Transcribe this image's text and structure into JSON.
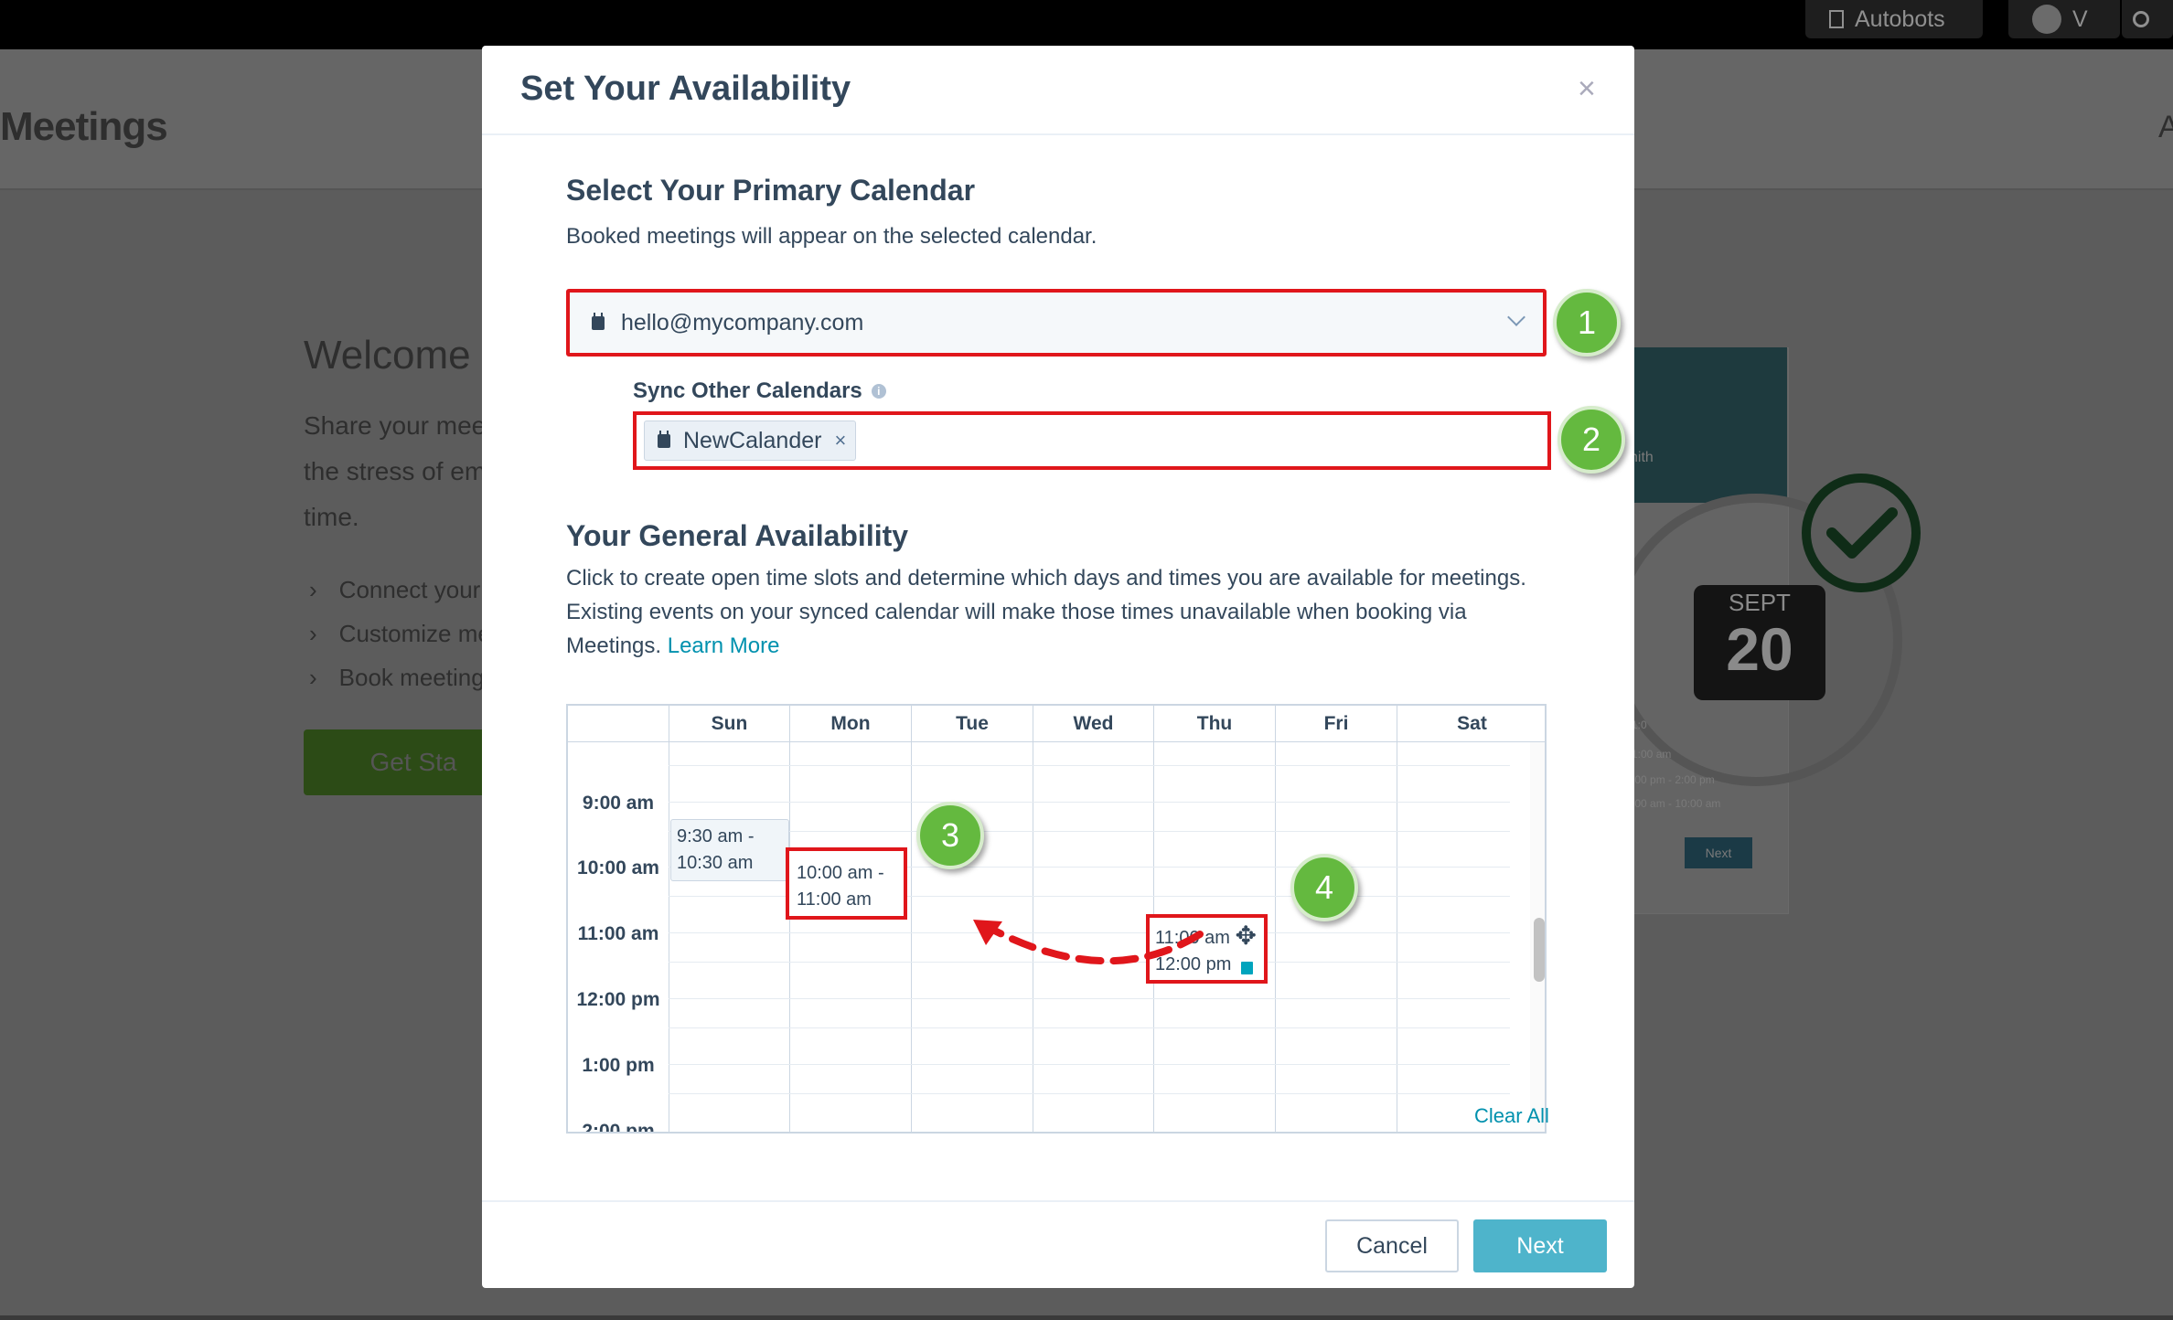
{
  "background": {
    "topbar": {
      "account_label": "Autobots",
      "user_initial": "V"
    },
    "page_title": "Meetings",
    "page_title_right_fragment": "A",
    "welcome_text": "Welcome t",
    "description_lines": [
      "Share your mee",
      "the stress of em",
      "time."
    ],
    "list_items": [
      "Connect your",
      "Customize me",
      "Book meeting"
    ],
    "get_started_label": "Get Sta",
    "illustration": {
      "name_fragment": "nith",
      "calendar_month": "SEPT",
      "calendar_day": "20",
      "small_times": [
        "1:0",
        "1:00 am",
        ":00 pm - 2:00 pm",
        ":00 am - 10:00 am"
      ],
      "small_next": "Next"
    }
  },
  "modal": {
    "title": "Set Your Availability",
    "close_symbol": "×",
    "primary_calendar": {
      "heading": "Select Your Primary Calendar",
      "description": "Booked meetings will appear on the selected calendar.",
      "selected_value": "hello@mycompany.com"
    },
    "sync": {
      "label": "Sync Other Calendars",
      "info_symbol": "i",
      "tags": [
        {
          "label": "NewCalander",
          "remove_symbol": "×"
        }
      ]
    },
    "availability": {
      "heading": "Your General Availability",
      "description_lines": [
        "Click to create open time slots and determine which days and times you are available for meetings.",
        "Existing events on your synced calendar will make those times unavailable when booking via",
        "Meetings."
      ],
      "learn_more": "Learn More",
      "days": [
        "Sun",
        "Mon",
        "Tue",
        "Wed",
        "Thu",
        "Fri",
        "Sat"
      ],
      "times": [
        "9:00 am",
        "10:00 am",
        "11:00 am",
        "12:00 pm",
        "1:00 pm",
        "2:00 pm"
      ],
      "slots": {
        "sun": [
          "9:30 am -",
          "10:30 am"
        ],
        "mon": [
          "10:00 am -",
          "11:00 am"
        ],
        "thu": [
          "11:00 am",
          "12:00 pm"
        ]
      },
      "clear_all": "Clear All"
    },
    "footer": {
      "cancel": "Cancel",
      "next": "Next"
    }
  },
  "callouts": [
    "1",
    "2",
    "3",
    "4"
  ],
  "colors": {
    "highlight_red": "#e0161b",
    "callout_green": "#64b93f",
    "next_button": "#4eb4cb",
    "link": "#0091ae"
  }
}
